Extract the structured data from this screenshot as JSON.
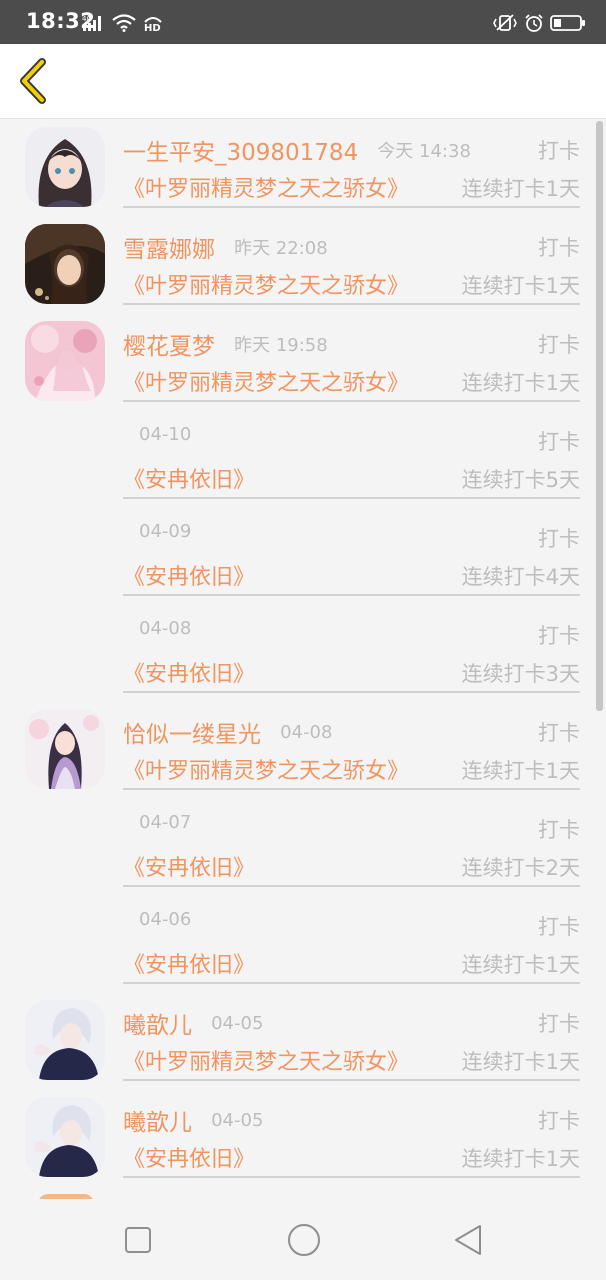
{
  "status_bar": {
    "time": "18:32",
    "network_label": "4G",
    "hd_label": "HD",
    "left_icons": [
      "signal-icon",
      "wifi-icon",
      "hd-voice-icon"
    ],
    "right_icons": [
      "vibrate-icon",
      "alarm-icon",
      "battery-icon"
    ]
  },
  "nav": {
    "back_icon": "chevron-left-icon",
    "accent_color": "#f5d000"
  },
  "colors": {
    "orange": "#f0955f",
    "gray_text": "#bdbdbd",
    "background": "#f5f4f5"
  },
  "records": [
    {
      "avatar": "avatar-anime-girl-dark-hair",
      "username": "一生平安_309801784",
      "time": "今天 14:38",
      "label": "打卡",
      "book": "《叶罗丽精灵梦之天之骄女》",
      "streak": "连续打卡1天"
    },
    {
      "avatar": "avatar-girl-photo",
      "username": "雪露娜娜",
      "time": "昨天 22:08",
      "label": "打卡",
      "book": "《叶罗丽精灵梦之天之骄女》",
      "streak": "连续打卡1天"
    },
    {
      "avatar": "avatar-pink-sakura",
      "username": "樱花夏梦",
      "time": "昨天 19:58",
      "label": "打卡",
      "book": "《叶罗丽精灵梦之天之骄女》",
      "streak": "连续打卡1天"
    },
    {
      "avatar": null,
      "username": "",
      "time": "04-10",
      "label": "打卡",
      "book": "《安冉依旧》",
      "streak": "连续打卡5天"
    },
    {
      "avatar": null,
      "username": "",
      "time": "04-09",
      "label": "打卡",
      "book": "《安冉依旧》",
      "streak": "连续打卡4天"
    },
    {
      "avatar": null,
      "username": "",
      "time": "04-08",
      "label": "打卡",
      "book": "《安冉依旧》",
      "streak": "连续打卡3天"
    },
    {
      "avatar": "avatar-kimono-girl",
      "username": "恰似一缕星光",
      "time": "04-08",
      "label": "打卡",
      "book": "《叶罗丽精灵梦之天之骄女》",
      "streak": "连续打卡1天"
    },
    {
      "avatar": null,
      "username": "",
      "time": "04-07",
      "label": "打卡",
      "book": "《安冉依旧》",
      "streak": "连续打卡2天"
    },
    {
      "avatar": null,
      "username": "",
      "time": "04-06",
      "label": "打卡",
      "book": "《安冉依旧》",
      "streak": "连续打卡1天"
    },
    {
      "avatar": "avatar-white-hair-boy",
      "username": "曦歆儿",
      "time": "04-05",
      "label": "打卡",
      "book": "《叶罗丽精灵梦之天之骄女》",
      "streak": "连续打卡1天"
    },
    {
      "avatar": "avatar-white-hair-boy",
      "username": "曦歆儿",
      "time": "04-05",
      "label": "打卡",
      "book": "《安冉依旧》",
      "streak": "连续打卡1天"
    }
  ],
  "system_nav": {
    "icons": [
      "recents-square-icon",
      "home-circle-icon",
      "back-triangle-icon"
    ]
  }
}
